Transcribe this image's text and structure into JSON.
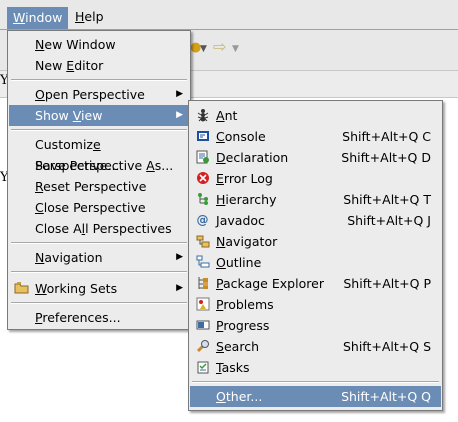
{
  "menubar": {
    "window": "Window",
    "help": "Help"
  },
  "background": {
    "text_left_1": "Y",
    "text_left_2": "Y"
  },
  "window_menu": {
    "items": [
      {
        "label": "New Window",
        "mn": 0
      },
      {
        "label": "New Editor",
        "mn": 4
      },
      {
        "label": "Open Perspective",
        "mn": 0
      },
      {
        "label": "Show View",
        "mn": 5
      },
      {
        "label": "Customize Perspective...",
        "mn": 8
      },
      {
        "label": "Save Perspective As...",
        "mn": 17
      },
      {
        "label": "Reset Perspective",
        "mn": 0
      },
      {
        "label": "Close Perspective",
        "mn": 0
      },
      {
        "label": "Close All Perspectives",
        "mn": 7
      },
      {
        "label": "Navigation",
        "mn": 0
      },
      {
        "label": "Working Sets",
        "mn": 0
      },
      {
        "label": "Preferences...",
        "mn": 0
      }
    ]
  },
  "show_view_menu": {
    "items": [
      {
        "label": "Ant",
        "mn": 0,
        "shortcut": "",
        "icon": "ant-icon"
      },
      {
        "label": "Console",
        "mn": 0,
        "shortcut": "Shift+Alt+Q C",
        "icon": "console-icon"
      },
      {
        "label": "Declaration",
        "mn": 0,
        "shortcut": "Shift+Alt+Q D",
        "icon": "declaration-icon"
      },
      {
        "label": "Error Log",
        "mn": 0,
        "shortcut": "",
        "icon": "error-log-icon"
      },
      {
        "label": "Hierarchy",
        "mn": 0,
        "shortcut": "Shift+Alt+Q T",
        "icon": "hierarchy-icon"
      },
      {
        "label": "Javadoc",
        "mn": 0,
        "shortcut": "Shift+Alt+Q J",
        "icon": "javadoc-icon"
      },
      {
        "label": "Navigator",
        "mn": 0,
        "shortcut": "",
        "icon": "navigator-icon"
      },
      {
        "label": "Outline",
        "mn": 0,
        "shortcut": "",
        "icon": "outline-icon"
      },
      {
        "label": "Package Explorer",
        "mn": 0,
        "shortcut": "Shift+Alt+Q P",
        "icon": "package-explorer-icon"
      },
      {
        "label": "Problems",
        "mn": 0,
        "shortcut": "",
        "icon": "problems-icon"
      },
      {
        "label": "Progress",
        "mn": 0,
        "shortcut": "",
        "icon": "progress-icon"
      },
      {
        "label": "Search",
        "mn": 0,
        "shortcut": "Shift+Alt+Q S",
        "icon": "search-icon"
      },
      {
        "label": "Tasks",
        "mn": 0,
        "shortcut": "",
        "icon": "tasks-icon"
      },
      {
        "label": "Other...",
        "mn": 0,
        "shortcut": "Shift+Alt+Q Q",
        "icon": ""
      }
    ]
  },
  "colors": {
    "highlight": "#6b8cb4",
    "menu_bg": "#ececec"
  }
}
